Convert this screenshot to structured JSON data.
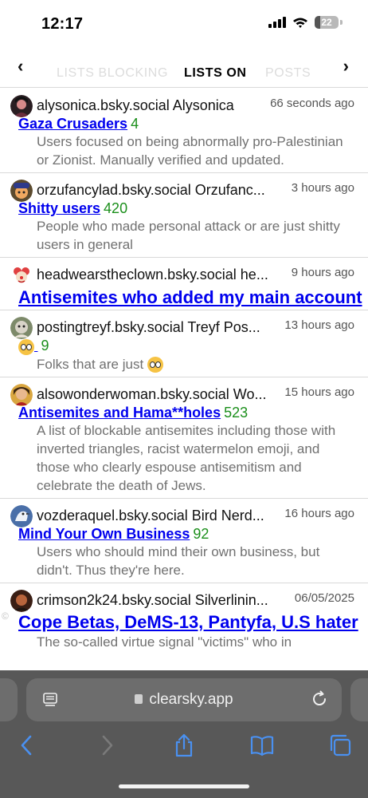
{
  "status": {
    "time": "12:17",
    "battery": "22",
    "battery_level": 0.22
  },
  "tabs": [
    "LISTS BLOCKING",
    "LISTS ON",
    "POSTS"
  ],
  "active_tab": "LISTS ON",
  "nav": {
    "prev": "‹",
    "next": "›"
  },
  "entries": [
    {
      "handle": "alysonica.bsky.social Alysonica",
      "time": "66 seconds ago",
      "list_name": "Gaza Crusaders",
      "count": "4",
      "description": "Users focused on being abnormally pro-Palestinian or Zionist. Manually verified and updated."
    },
    {
      "handle": "orzufancylad.bsky.social Orzufanc...",
      "time": "3 hours ago",
      "list_name": "Shitty users",
      "count": "420",
      "description": "People who made personal attack or are just shitty users in general"
    },
    {
      "handle": "headwearstheclown.bsky.social he...",
      "time": "9 hours ago",
      "list_name": "Antisemites who added my main account",
      "count": "",
      "description": ""
    },
    {
      "handle": "postingtreyf.bsky.social Treyf Pos...",
      "time": "13 hours ago",
      "list_name": "",
      "count": "9",
      "description": "Folks that are just"
    },
    {
      "handle": "alsowonderwoman.bsky.social Wo...",
      "time": "15 hours ago",
      "list_name": "Antisemites and Hama**holes",
      "count": "523",
      "description": "A list of blockable antisemites including those with inverted triangles, racist watermelon emoji, and those who clearly espouse antisemitism and celebrate the death of Jews."
    },
    {
      "handle": "vozderaquel.bsky.social Bird Nerd...",
      "time": "16 hours ago",
      "list_name": "Mind Your Own Business",
      "count": "92",
      "description": "Users who should mind their own business, but didn't. Thus they're here."
    },
    {
      "handle": "crimson2k24.bsky.social Silverlinin...",
      "time": "06/05/2025",
      "list_name": "Cope Betas, DeMS-13, Pantyfa, U.S hater",
      "count": "",
      "description": "The so-called virtue signal \"victims\" who in"
    }
  ],
  "watermark": "©",
  "browser": {
    "url": "clearsky.app"
  }
}
